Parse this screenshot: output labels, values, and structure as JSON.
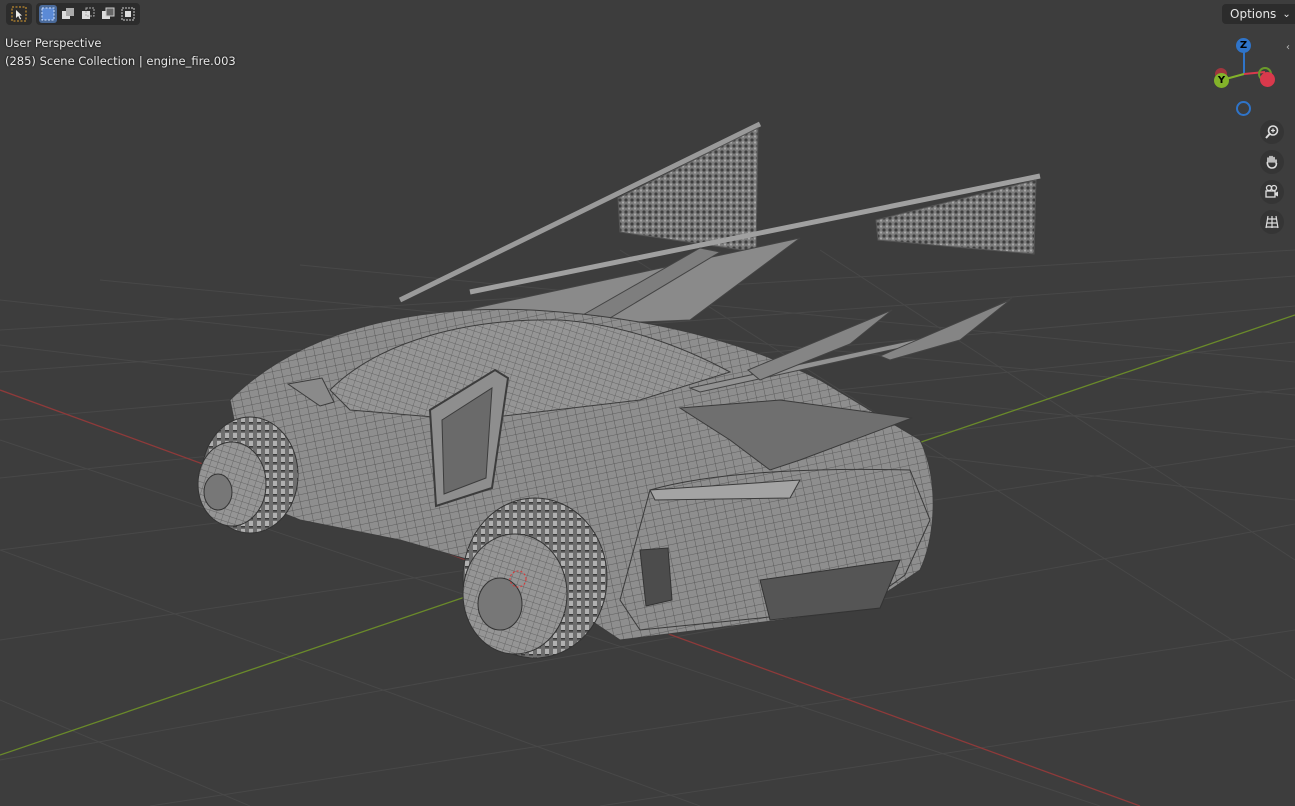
{
  "header": {
    "select_tool_icon": "cursor-select-icon",
    "mode_icons": [
      "select-new-icon",
      "select-extend-icon",
      "select-subtract-icon",
      "select-intersect-icon"
    ],
    "options_label": "Options"
  },
  "viewport": {
    "view_name": "User Perspective",
    "collection_info": "(285) Scene Collection | engine_fire.003"
  },
  "gizmo": {
    "z_label": "Z",
    "y_label": "Y",
    "colors": {
      "x": "#d9394c",
      "y": "#83b32a",
      "z": "#2f74c9"
    }
  },
  "nav_buttons": [
    "zoom-icon",
    "pan-hand-icon",
    "camera-icon",
    "grid-ortho-icon"
  ],
  "colors": {
    "background": "#3d3d3d",
    "grid": "#4a4a4a",
    "x_axis": "#9b3a3a",
    "y_axis": "#6a8a2a",
    "model": "#8c8c8c"
  }
}
